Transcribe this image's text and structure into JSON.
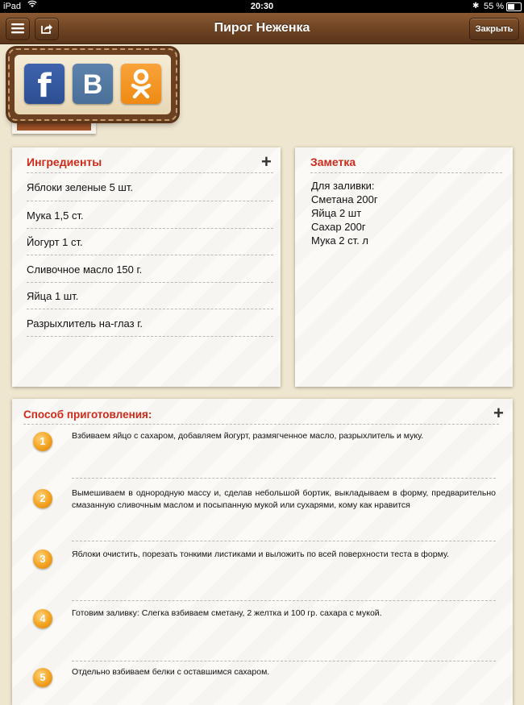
{
  "status_bar": {
    "carrier": "iPad",
    "time": "20:30",
    "battery": "55 %",
    "battery_level": 0.55
  },
  "nav": {
    "title": "Пирог Неженка",
    "close_label": "Закрыть"
  },
  "share": {
    "facebook": "f",
    "vkontakte": "B"
  },
  "ingredients": {
    "title": "Ингредиенты",
    "add": "+",
    "items": [
      "Яблоки зеленые 5 шт.",
      "Мука 1,5 ст.",
      "Йогурт 1 ст.",
      "Сливочное масло 150 г.",
      "Яйца 1 шт.",
      "Разрыхлитель на-глаз г."
    ]
  },
  "note": {
    "title": "Заметка",
    "text": "Для заливки:\nСметана 200г\nЯйца 2 шт\nСахар 200г\nМука 2 ст. л"
  },
  "method": {
    "title": "Способ приготовления:",
    "add": "+",
    "steps": [
      {
        "num": "1",
        "text": "Взбиваем яйцо с сахаром, добавляем йогурт, размягченное масло, разрыхлитель и муку."
      },
      {
        "num": "2",
        "text": "Вымешиваем в однородную массу и, сделав небольшой бортик, выкладываем в форму, предварительно смазанную сливочным маслом и посыпанную мукой или сухарями, кому как нравится"
      },
      {
        "num": "3",
        "text": "Яблоки очистить, порезать тонкими листиками и выложить по всей поверхности теста в форму."
      },
      {
        "num": "4",
        "text": "Готовим заливку: Слегка взбиваем сметану, 2 желтка и 100 гр. сахара с мукой."
      },
      {
        "num": "5",
        "text": "Отдельно взбиваем белки с оставшимся сахаром."
      }
    ]
  }
}
